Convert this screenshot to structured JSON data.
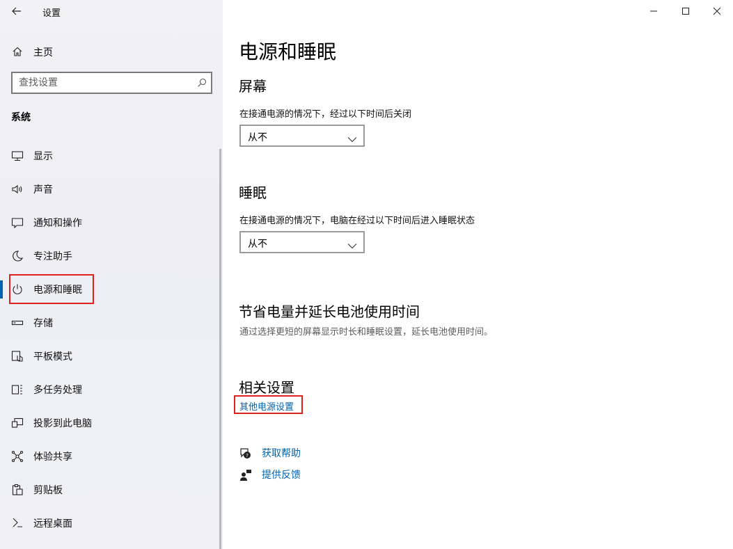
{
  "window": {
    "title": "设置",
    "controls": {
      "minimize": "minimize-icon",
      "maximize": "maximize-icon",
      "close": "close-icon"
    }
  },
  "sidebar": {
    "home_label": "主页",
    "search_placeholder": "查找设置",
    "section_label": "系统",
    "items": [
      {
        "label": "显示",
        "icon": "display-icon"
      },
      {
        "label": "声音",
        "icon": "speaker-icon"
      },
      {
        "label": "通知和操作",
        "icon": "notification-icon"
      },
      {
        "label": "专注助手",
        "icon": "moon-icon"
      },
      {
        "label": "电源和睡眠",
        "icon": "power-icon",
        "active": true
      },
      {
        "label": "存储",
        "icon": "storage-icon"
      },
      {
        "label": "平板模式",
        "icon": "tablet-icon"
      },
      {
        "label": "多任务处理",
        "icon": "multitask-icon"
      },
      {
        "label": "投影到此电脑",
        "icon": "project-icon"
      },
      {
        "label": "体验共享",
        "icon": "share-icon"
      },
      {
        "label": "剪贴板",
        "icon": "clipboard-icon"
      },
      {
        "label": "远程桌面",
        "icon": "remote-icon"
      }
    ]
  },
  "main": {
    "title": "电源和睡眠",
    "screen": {
      "heading": "屏幕",
      "description": "在接通电源的情况下，经过以下时间后关闭",
      "value": "从不"
    },
    "sleep": {
      "heading": "睡眠",
      "description": "在接通电源的情况下，电脑在经过以下时间后进入睡眠状态",
      "value": "从不"
    },
    "battery": {
      "heading": "节省电量并延长电池使用时间",
      "description": "通过选择更短的屏幕显示时长和睡眠设置，延长电池使用时间。"
    },
    "related": {
      "heading": "相关设置",
      "link": "其他电源设置"
    },
    "help": {
      "get_help": "获取帮助",
      "feedback": "提供反馈"
    }
  },
  "colors": {
    "accent": "#0063b1",
    "highlight": "#e0201c"
  }
}
